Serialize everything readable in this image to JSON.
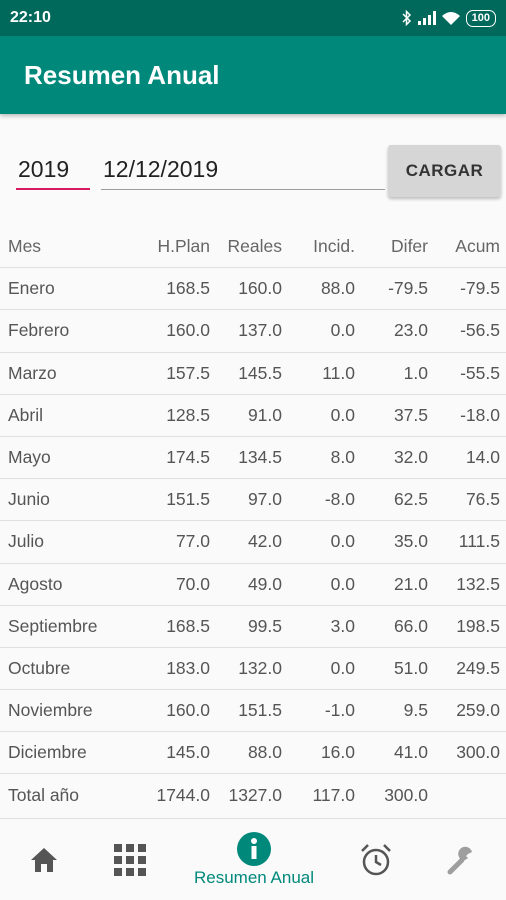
{
  "status_bar": {
    "time": "22:10",
    "battery": "100"
  },
  "app_bar": {
    "title": "Resumen Anual"
  },
  "form": {
    "year": "2019",
    "date": "12/12/2019",
    "load_button": "CARGAR"
  },
  "table": {
    "headers": {
      "mes": "Mes",
      "plan": "H.Plan",
      "reales": "Reales",
      "incid": "Incid.",
      "difer": "Difer",
      "acum": "Acum"
    },
    "rows": [
      {
        "mes": "Enero",
        "plan": "168.5",
        "reales": "160.0",
        "incid": "88.0",
        "difer": "-79.5",
        "acum": "-79.5"
      },
      {
        "mes": "Febrero",
        "plan": "160.0",
        "reales": "137.0",
        "incid": "0.0",
        "difer": "23.0",
        "acum": "-56.5"
      },
      {
        "mes": "Marzo",
        "plan": "157.5",
        "reales": "145.5",
        "incid": "11.0",
        "difer": "1.0",
        "acum": "-55.5"
      },
      {
        "mes": "Abril",
        "plan": "128.5",
        "reales": "91.0",
        "incid": "0.0",
        "difer": "37.5",
        "acum": "-18.0"
      },
      {
        "mes": "Mayo",
        "plan": "174.5",
        "reales": "134.5",
        "incid": "8.0",
        "difer": "32.0",
        "acum": "14.0"
      },
      {
        "mes": "Junio",
        "plan": "151.5",
        "reales": "97.0",
        "incid": "-8.0",
        "difer": "62.5",
        "acum": "76.5"
      },
      {
        "mes": "Julio",
        "plan": "77.0",
        "reales": "42.0",
        "incid": "0.0",
        "difer": "35.0",
        "acum": "111.5"
      },
      {
        "mes": "Agosto",
        "plan": "70.0",
        "reales": "49.0",
        "incid": "0.0",
        "difer": "21.0",
        "acum": "132.5"
      },
      {
        "mes": "Septiembre",
        "plan": "168.5",
        "reales": "99.5",
        "incid": "3.0",
        "difer": "66.0",
        "acum": "198.5"
      },
      {
        "mes": "Octubre",
        "plan": "183.0",
        "reales": "132.0",
        "incid": "0.0",
        "difer": "51.0",
        "acum": "249.5"
      },
      {
        "mes": "Noviembre",
        "plan": "160.0",
        "reales": "151.5",
        "incid": "-1.0",
        "difer": "9.5",
        "acum": "259.0"
      },
      {
        "mes": "Diciembre",
        "plan": "145.0",
        "reales": "88.0",
        "incid": "16.0",
        "difer": "41.0",
        "acum": "300.0"
      }
    ],
    "total": {
      "mes": "Total año",
      "plan": "1744.0",
      "reales": "1327.0",
      "incid": "117.0",
      "difer": "300.0",
      "acum": ""
    }
  },
  "bottom_nav": {
    "items": [
      {
        "icon": "home-icon",
        "label": ""
      },
      {
        "icon": "grid-icon",
        "label": ""
      },
      {
        "icon": "info-icon",
        "label": "Resumen Anual",
        "active": true
      },
      {
        "icon": "alarm-icon",
        "label": ""
      },
      {
        "icon": "wrench-icon",
        "label": ""
      }
    ]
  },
  "colors": {
    "primary": "#00897b",
    "primary_dark": "#00695c",
    "accent": "#d81b60",
    "inactive_icon": "#555555",
    "disabled_icon": "#9e9e9e"
  }
}
